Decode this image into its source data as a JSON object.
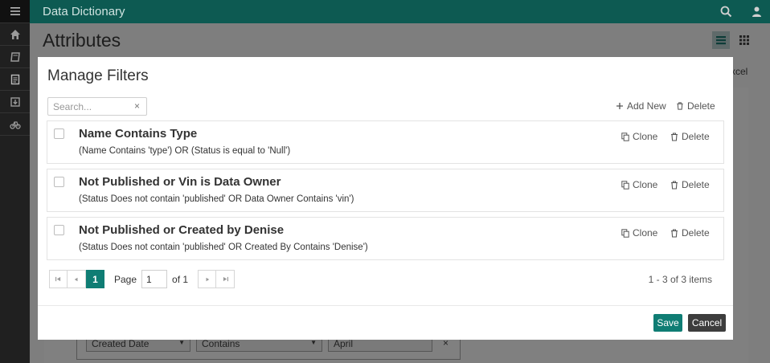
{
  "app": {
    "title": "Data Dictionary"
  },
  "page": {
    "title": "Attributes",
    "excel_label": "xcel",
    "filter_row": {
      "field": "Created Date",
      "operator": "Contains",
      "value": "April"
    }
  },
  "modal": {
    "title": "Manage Filters",
    "search_placeholder": "Search...",
    "clear_glyph": "×",
    "add_new_label": "Add New",
    "delete_label": "Delete",
    "clone_label": "Clone",
    "filters": [
      {
        "name": "Name Contains Type",
        "expression": "(Name Contains 'type') OR (Status is equal to 'Null')"
      },
      {
        "name": "Not Published or Vin is Data Owner",
        "expression": "(Status Does not contain 'published' OR Data Owner Contains 'vin')"
      },
      {
        "name": "Not Published or Created by Denise",
        "expression": "(Status Does not contain 'published' OR Created By Contains 'Denise')"
      }
    ],
    "pager": {
      "current": "1",
      "page_label": "Page",
      "page_value": "1",
      "of_label": "of 1",
      "summary": "1 - 3 of 3 items"
    },
    "save_label": "Save",
    "cancel_label": "Cancel"
  },
  "colors": {
    "accent": "#0f7d74",
    "topbar": "#0d5a52",
    "rail": "#202020",
    "cancel": "#3d3d3d"
  },
  "icons": [
    "menu-icon",
    "home-icon",
    "book-icon",
    "document-icon",
    "download-icon",
    "bicycle-icon",
    "search-icon",
    "user-icon",
    "list-view-icon",
    "grid-view-icon",
    "plus-icon",
    "trash-icon",
    "clone-icon",
    "first-page-icon",
    "prev-page-icon",
    "next-page-icon",
    "last-page-icon"
  ]
}
